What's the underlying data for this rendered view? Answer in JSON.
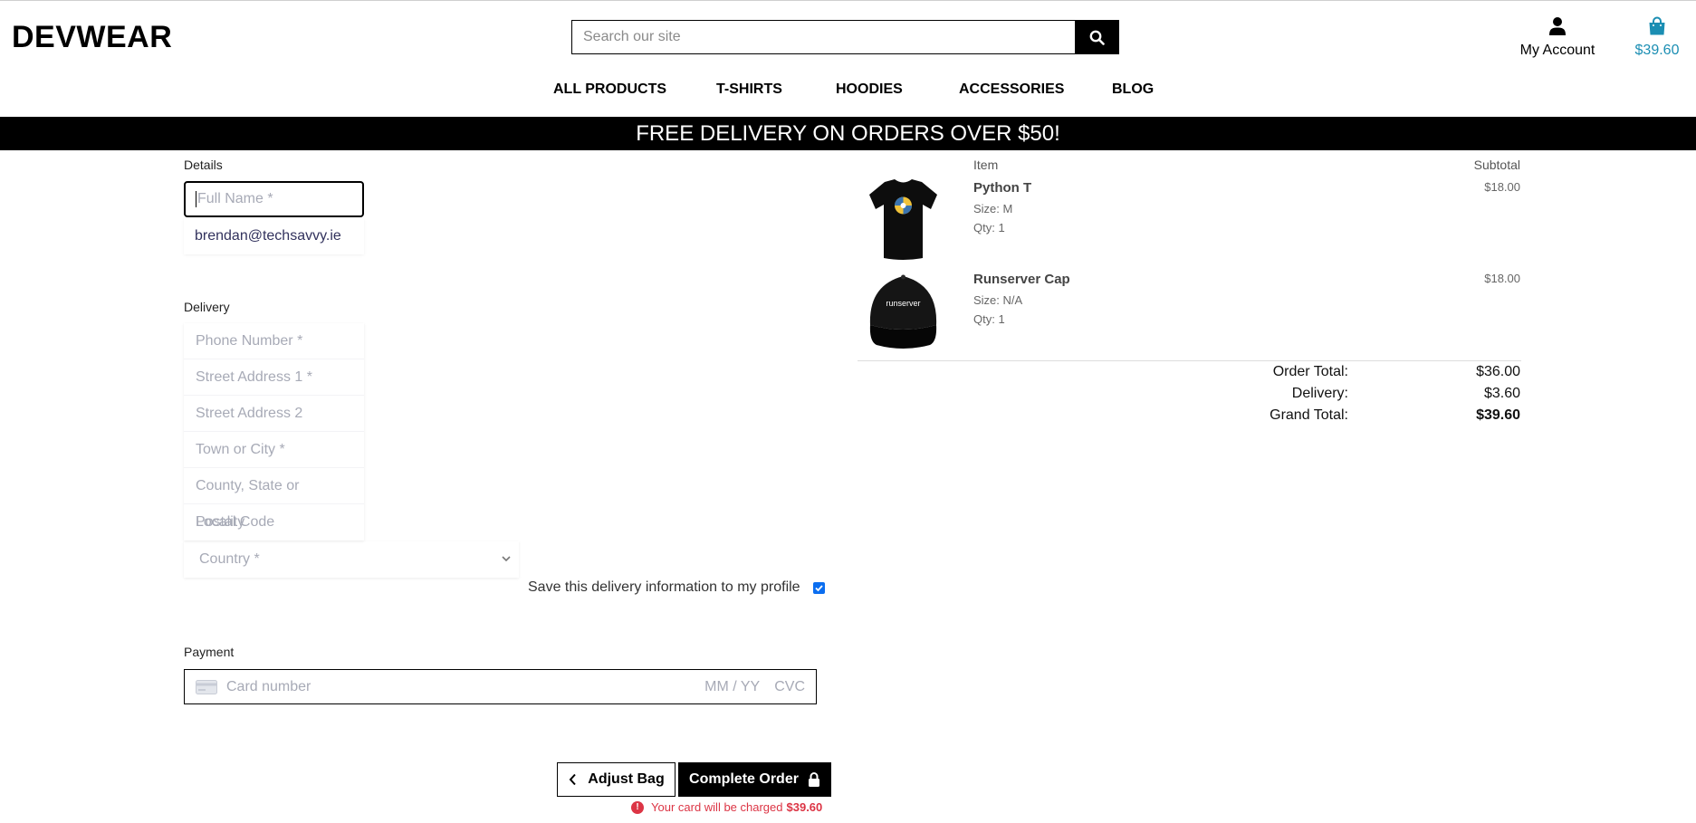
{
  "brand": {
    "logo": "DEVWEAR"
  },
  "search": {
    "placeholder": "Search our site"
  },
  "header": {
    "account_label": "My Account",
    "bag_total": "$39.60"
  },
  "nav": {
    "items": [
      "ALL PRODUCTS",
      "T-SHIRTS",
      "HOODIES",
      "ACCESSORIES",
      "BLOG"
    ]
  },
  "banner": {
    "text": "FREE DELIVERY ON ORDERS OVER $50!"
  },
  "details": {
    "label": "Details",
    "full_name_placeholder": "Full Name *",
    "email_value": "brendan@techsavvy.ie"
  },
  "delivery": {
    "label": "Delivery",
    "fields": [
      "Phone Number *",
      "Street Address 1 *",
      "Street Address 2",
      "Town or City *",
      "County, State or Locality",
      "Postal Code"
    ],
    "country_placeholder": "Country *",
    "save_label": "Save this delivery information to my profile",
    "save_checked": true
  },
  "payment": {
    "label": "Payment",
    "card_placeholder": "Card number",
    "exp_placeholder": "MM / YY",
    "cvc_placeholder": "CVC"
  },
  "actions": {
    "adjust_label": "Adjust Bag",
    "complete_label": "Complete Order",
    "charge_text": "Your card will be charged",
    "charge_amount": "$39.60"
  },
  "summary": {
    "col_item": "Item",
    "col_subtotal": "Subtotal",
    "items": [
      {
        "name": "Python T",
        "size": "Size: M",
        "qty": "Qty: 1",
        "price": "$18.00"
      },
      {
        "name": "Runserver Cap",
        "size": "Size: N/A",
        "qty": "Qty: 1",
        "price": "$18.00",
        "print": "runserver"
      }
    ],
    "order_total_label": "Order Total:",
    "order_total": "$36.00",
    "delivery_label": "Delivery:",
    "delivery": "$3.60",
    "grand_total_label": "Grand Total:",
    "grand_total": "$39.60"
  },
  "colors": {
    "accent": "#1b8eb3",
    "error": "#dc3545",
    "checkbox": "#0b6ef0"
  }
}
